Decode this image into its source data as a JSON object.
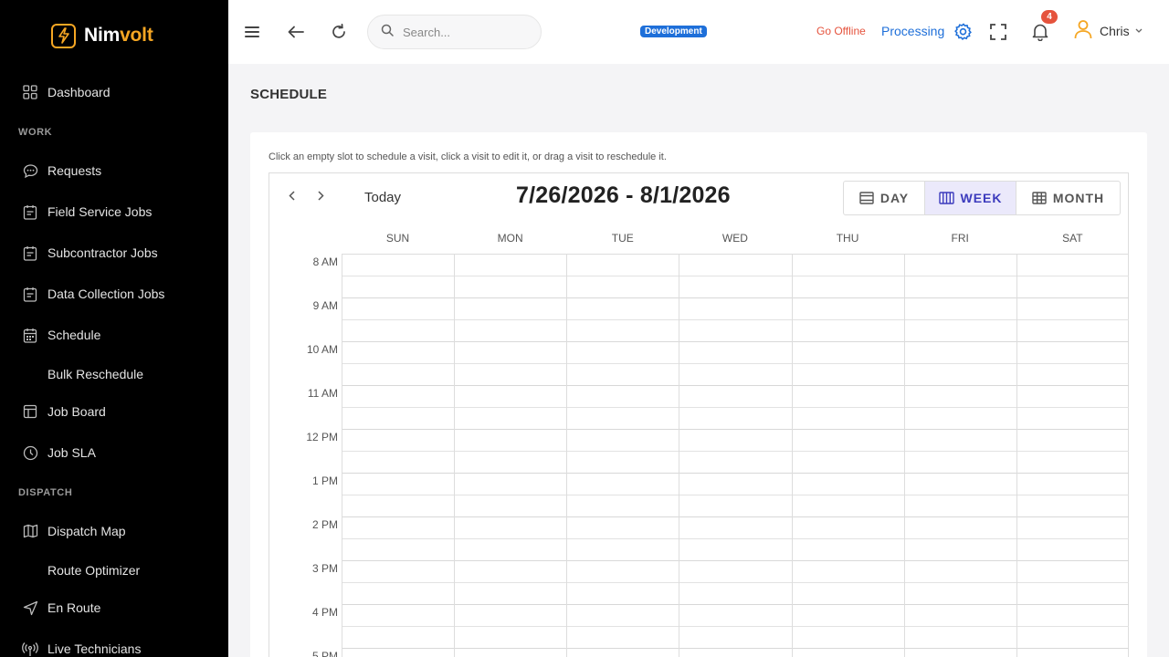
{
  "brand": {
    "name_part1": "Nim",
    "name_part2": "volt",
    "accent": "#f5a623"
  },
  "sidebar": {
    "items": [
      {
        "label": "Dashboard",
        "icon": "grid-icon"
      },
      {
        "section": "WORK"
      },
      {
        "label": "Requests",
        "icon": "chat-icon"
      },
      {
        "label": "Field Service Jobs",
        "icon": "clipboard-icon"
      },
      {
        "label": "Subcontractor Jobs",
        "icon": "clipboard-icon"
      },
      {
        "label": "Data Collection Jobs",
        "icon": "clipboard-icon"
      },
      {
        "label": "Schedule",
        "icon": "calendar-icon"
      },
      {
        "label": "Bulk Reschedule"
      },
      {
        "label": "Job Board",
        "icon": "board-icon"
      },
      {
        "label": "Job SLA",
        "icon": "clock-icon"
      },
      {
        "section": "DISPATCH"
      },
      {
        "label": "Dispatch Map",
        "icon": "map-icon"
      },
      {
        "label": "Route Optimizer"
      },
      {
        "label": "En Route",
        "icon": "navigation-icon"
      },
      {
        "label": "Live Technicians",
        "icon": "broadcast-icon"
      }
    ]
  },
  "topbar": {
    "search_placeholder": "Search...",
    "env_badge": "Development",
    "go_offline": "Go Offline",
    "processing": "Processing",
    "notification_count": "4",
    "user_name": "Chris"
  },
  "page": {
    "title": "SCHEDULE",
    "hint": "Click an empty slot to schedule a visit, click a visit to edit it, or drag a visit to reschedule it."
  },
  "calendar": {
    "today_label": "Today",
    "range": "7/26/2026 - 8/1/2026",
    "views": [
      {
        "label": "DAY",
        "icon": "day-view-icon",
        "active": false
      },
      {
        "label": "WEEK",
        "icon": "week-view-icon",
        "active": true
      },
      {
        "label": "MONTH",
        "icon": "month-view-icon",
        "active": false
      }
    ],
    "days": [
      "SUN",
      "MON",
      "TUE",
      "WED",
      "THU",
      "FRI",
      "SAT"
    ],
    "times": [
      "8 AM",
      "9 AM",
      "10 AM",
      "11 AM",
      "12 PM",
      "1 PM",
      "2 PM",
      "3 PM",
      "4 PM",
      "5 PM"
    ]
  }
}
